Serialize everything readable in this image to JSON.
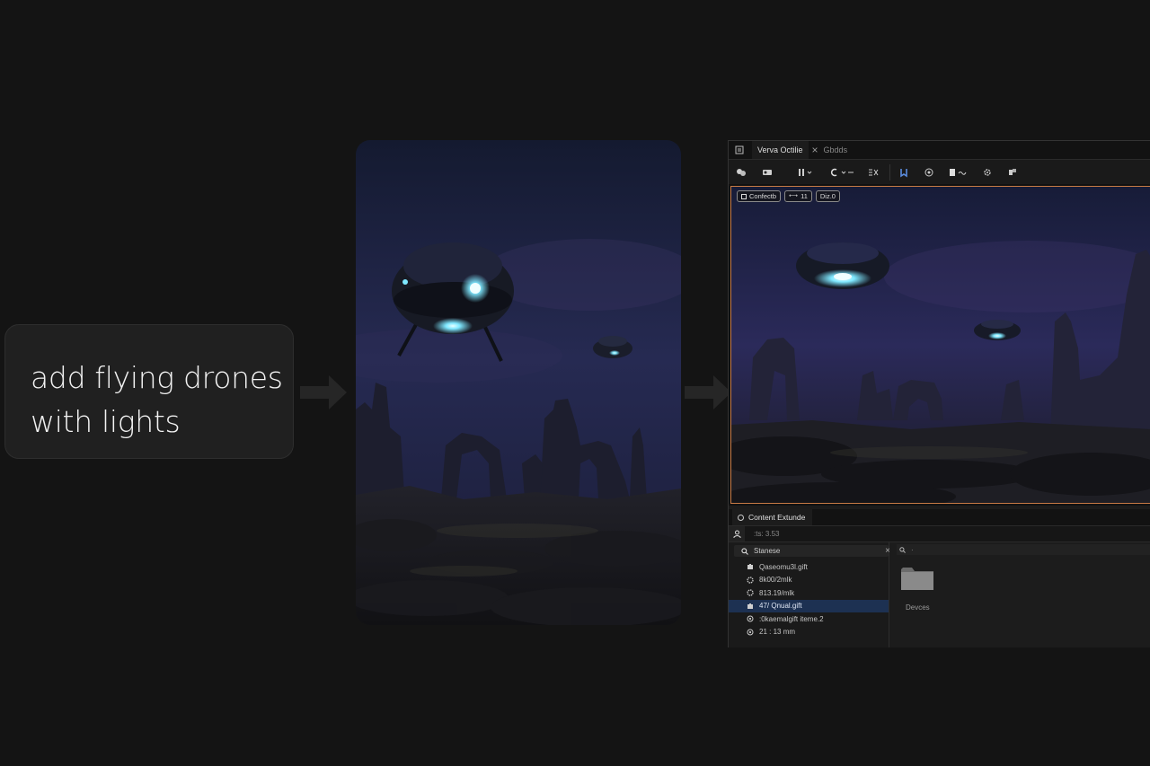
{
  "prompt": {
    "line1": "add flying drones",
    "line2": "with lights"
  },
  "editor": {
    "tabs": {
      "active": "Verva Octilie",
      "second": "Gbdds"
    },
    "toolbar_icons": [
      "blueprint-icon",
      "cinematics-icon",
      "grid-icon",
      "snap-icon",
      "transform-icon",
      "play-icon",
      "camera-icon",
      "bookmark-icon",
      "settings-icon",
      "build-icon"
    ],
    "viewport": {
      "badge1": "Confectb",
      "badge2": "11",
      "badge3": "Diz.0"
    },
    "content_browser": {
      "tab_label": "Content Extunde",
      "path_text": ":ts: 3.53",
      "search_label": "Stanese",
      "search_close": "×",
      "right_search_text": "·",
      "items": [
        {
          "label": "Qaseomu3l.gift",
          "icon": "puzzle-icon"
        },
        {
          "label": "8k00/2mlk",
          "icon": "gear-icon"
        },
        {
          "label": "813.19/mlk",
          "icon": "gear-icon"
        },
        {
          "label": "47/ Qnual.gift",
          "icon": "puzzle-icon",
          "selected": true
        },
        {
          "label": ":0kaemalgift iteme.2",
          "icon": "circle-icon"
        },
        {
          "label": "21 : 13 mm",
          "icon": "circle-icon"
        }
      ],
      "folder_label": "Devces"
    }
  },
  "colors": {
    "background": "#141414",
    "viewport_border": "#c77a45",
    "selected_row": "#1d3152",
    "drone_light": "#7fe8ff"
  }
}
